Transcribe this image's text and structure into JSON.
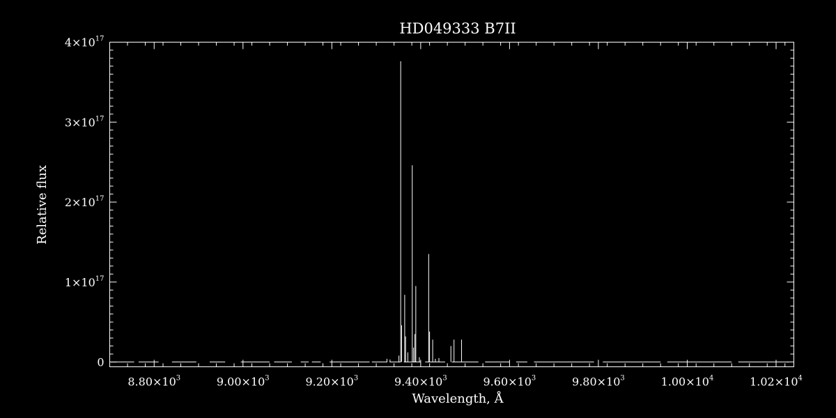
{
  "chart_data": {
    "type": "line",
    "title": "HD049333   B7II",
    "xlabel": "Wavelength, Å",
    "ylabel": "Relative flux",
    "xlim": [
      8700,
      10240
    ],
    "ylim": [
      -6000000000000000.0,
      4e+17
    ],
    "grid": false,
    "legend": "none",
    "colors": {
      "background": "#000000",
      "foreground": "#ffffff"
    },
    "x_ticks": [
      {
        "value": 8800,
        "mantissa": "8.80×10",
        "exp": "3"
      },
      {
        "value": 9000,
        "mantissa": "9.00×10",
        "exp": "3"
      },
      {
        "value": 9200,
        "mantissa": "9.20×10",
        "exp": "3"
      },
      {
        "value": 9400,
        "mantissa": "9.40×10",
        "exp": "3"
      },
      {
        "value": 9600,
        "mantissa": "9.60×10",
        "exp": "3"
      },
      {
        "value": 9800,
        "mantissa": "9.80×10",
        "exp": "3"
      },
      {
        "value": 10000,
        "mantissa": "1.00×10",
        "exp": "4"
      },
      {
        "value": 10200,
        "mantissa": "1.02×10",
        "exp": "4"
      }
    ],
    "y_ticks": [
      {
        "value": 0,
        "mantissa": "0",
        "exp": ""
      },
      {
        "value": 1e+17,
        "mantissa": "1×10",
        "exp": "17"
      },
      {
        "value": 2e+17,
        "mantissa": "2×10",
        "exp": "17"
      },
      {
        "value": 3e+17,
        "mantissa": "3×10",
        "exp": "17"
      },
      {
        "value": 4e+17,
        "mantissa": "4×10",
        "exp": "17"
      }
    ],
    "series": [
      {
        "baseline_segments": [
          [
            8702,
            8755
          ],
          [
            8765,
            8810
          ],
          [
            8840,
            8895
          ],
          [
            8925,
            8960
          ],
          [
            8995,
            9060
          ],
          [
            9070,
            9110
          ],
          [
            9130,
            9148
          ],
          [
            9155,
            9175
          ],
          [
            9195,
            9285
          ],
          [
            9290,
            9325
          ],
          [
            9330,
            9355
          ],
          [
            9362,
            9400
          ],
          [
            9410,
            9455
          ],
          [
            9470,
            9530
          ],
          [
            9545,
            9600
          ],
          [
            9615,
            9640
          ],
          [
            9655,
            9790
          ],
          [
            9810,
            9940
          ],
          [
            9955,
            10100
          ],
          [
            10115,
            10228
          ]
        ],
        "lines": [
          {
            "x": 9355,
            "y": 3.76e+17
          },
          {
            "x": 9357,
            "y": 4.6e+16
          },
          {
            "x": 9364,
            "y": 8.4e+16
          },
          {
            "x": 9366,
            "y": 3.2e+16
          },
          {
            "x": 9371,
            "y": 1.2e+16
          },
          {
            "x": 9381,
            "y": 2.46e+17
          },
          {
            "x": 9384,
            "y": 1.8e+16
          },
          {
            "x": 9387,
            "y": 3.5e+16
          },
          {
            "x": 9389,
            "y": 9.5e+16
          },
          {
            "x": 9397,
            "y": 6000000000000000.0
          },
          {
            "x": 9418,
            "y": 1.35e+17
          },
          {
            "x": 9420,
            "y": 3.8e+16
          },
          {
            "x": 9427,
            "y": 2.8e+16
          },
          {
            "x": 9433,
            "y": 4000000000000000.0
          },
          {
            "x": 9441,
            "y": 5000000000000000.0
          },
          {
            "x": 9468,
            "y": 2e+16
          },
          {
            "x": 9475,
            "y": 2.8e+16
          },
          {
            "x": 9492,
            "y": 2.8e+16
          },
          {
            "x": 9324,
            "y": 4000000000000000.0
          },
          {
            "x": 9331,
            "y": 3000000000000000.0
          },
          {
            "x": 9351,
            "y": 8000000000000000.0
          }
        ]
      }
    ]
  }
}
